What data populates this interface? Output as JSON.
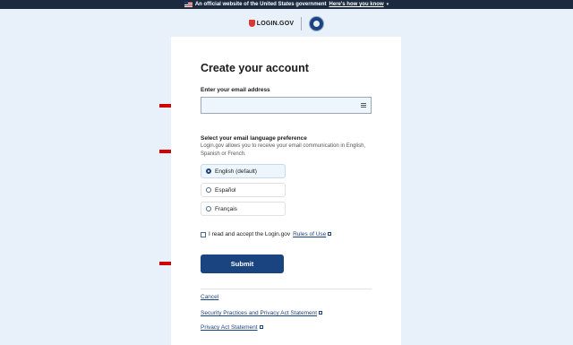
{
  "banner": {
    "text": "An official website of the United States government",
    "link": "Here's how you know"
  },
  "header": {
    "logo": "LOGIN.GOV"
  },
  "form": {
    "title": "Create your account",
    "email_label": "Enter your email address",
    "email_value": "",
    "language_label": "Select your email language preference",
    "language_hint": "Login.gov allows you to receive your email communication in English, Spanish or French.",
    "languages": [
      {
        "label": "English (default)",
        "selected": true
      },
      {
        "label": "Español",
        "selected": false
      },
      {
        "label": "Français",
        "selected": false
      }
    ],
    "terms_text": "I read and accept the Login.gov",
    "terms_link": "Rules of Use",
    "submit_label": "Submit"
  },
  "footer_links": {
    "cancel": "Cancel",
    "security": "Security Practices and Privacy Act Statement",
    "privacy": "Privacy Act Statement"
  },
  "colors": {
    "primary": "#1a4480",
    "annotation_arrow": "#d00000",
    "page_background": "#e8f0f9"
  }
}
